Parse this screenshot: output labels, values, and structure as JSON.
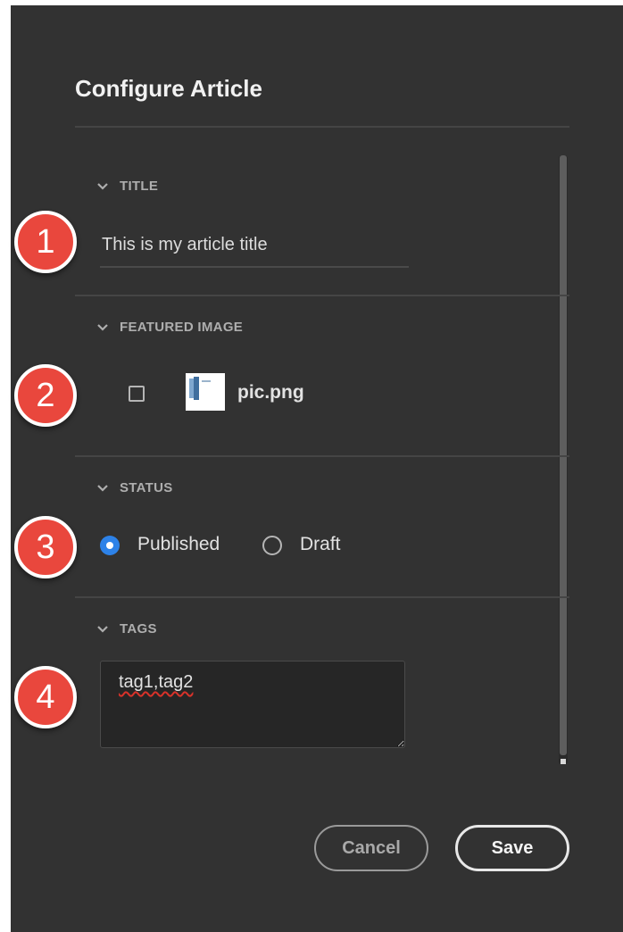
{
  "dialog": {
    "title": "Configure Article",
    "sections": {
      "title": {
        "header": "TITLE",
        "value": "This is my article title"
      },
      "featured_image": {
        "header": "FEATURED IMAGE",
        "file_name": "pic.png"
      },
      "status": {
        "header": "STATUS",
        "options": [
          "Published",
          "Draft"
        ],
        "selected": "Published"
      },
      "tags": {
        "header": "TAGS",
        "value": "tag1,tag2"
      }
    },
    "buttons": {
      "cancel": "Cancel",
      "save": "Save"
    }
  },
  "callouts": [
    "1",
    "2",
    "3",
    "4"
  ],
  "colors": {
    "background": "#323232",
    "accent": "#2d82e8",
    "callout": "#e9473d"
  },
  "icons": {
    "section_toggle": "chevron-down-icon",
    "thumbnail": "image-thumbnail-icon"
  }
}
